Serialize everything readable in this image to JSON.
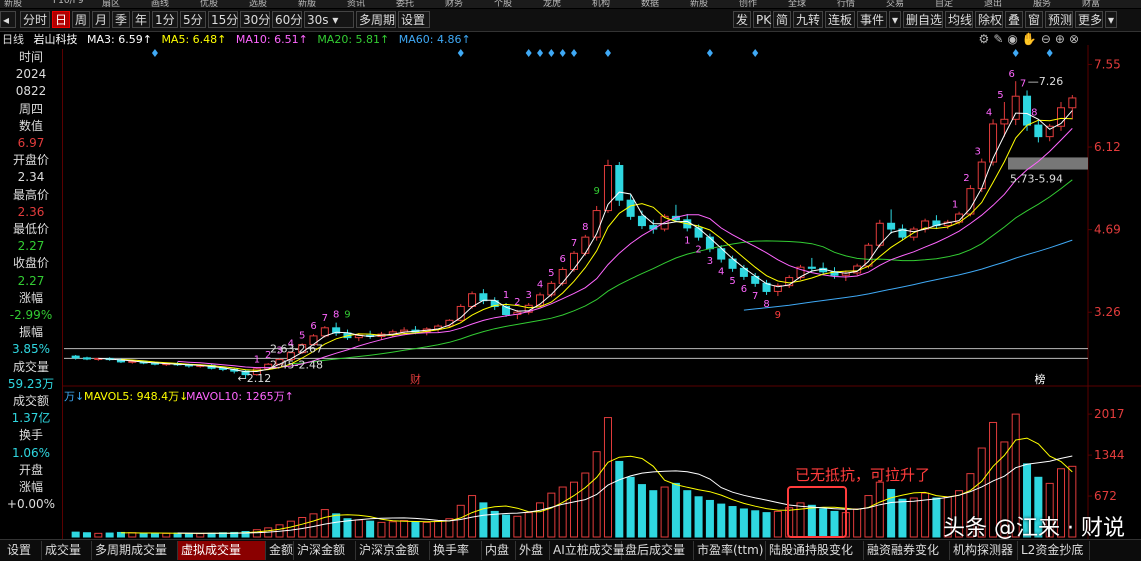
{
  "top_menu": [
    "新股",
    "F10/F9",
    "扇区",
    "画线",
    "优股",
    "选股",
    "新版",
    "资讯",
    "委托",
    "财务",
    "个股",
    "龙虎",
    "机构",
    "数据",
    "新股",
    "创作",
    "全球",
    "行情",
    "交易",
    "自定",
    "退出",
    "服务",
    "财富"
  ],
  "toolbar": {
    "items": [
      "分时",
      "日",
      "周",
      "月",
      "季",
      "年",
      "1分",
      "5分",
      "15分",
      "30分",
      "60分",
      "30s ▾",
      "多周期",
      "设置"
    ],
    "right_items": [
      "发",
      "PK",
      "简",
      "九转",
      "连板",
      "事件",
      "▾",
      "删自选",
      "均线",
      "除权",
      "叠",
      "窗",
      "预测",
      "更多",
      "▾"
    ]
  },
  "ma_bar": {
    "period": "日线",
    "name": "岩山科技",
    "ma3": "MA3: 6.59↑",
    "ma5": "MA5: 6.48↑",
    "ma10": "MA10: 6.51↑",
    "ma20": "MA20: 5.81↑",
    "ma60": "MA60: 4.86↑"
  },
  "colors": {
    "up": "#e23c3c",
    "down": "#2fd7e0",
    "ma3": "#ffffff",
    "ma5": "#ffff00",
    "ma10": "#ff66ff",
    "ma20": "#33cc33",
    "ma60": "#3fa9f5",
    "axis": "#5a0000"
  },
  "side_panel": [
    {
      "text": "时间",
      "color": "#ddd"
    },
    {
      "text": "2024",
      "color": "#ddd"
    },
    {
      "text": "0822",
      "color": "#ddd"
    },
    {
      "text": "周四",
      "color": "#ddd"
    },
    {
      "text": "数值",
      "color": "#ddd"
    },
    {
      "text": "6.97",
      "color": "#e23c3c"
    },
    {
      "text": "开盘价",
      "color": "#ddd"
    },
    {
      "text": "2.34",
      "color": "#ddd"
    },
    {
      "text": "最高价",
      "color": "#ddd"
    },
    {
      "text": "2.36",
      "color": "#e23c3c"
    },
    {
      "text": "最低价",
      "color": "#ddd"
    },
    {
      "text": "2.27",
      "color": "#33cc33"
    },
    {
      "text": "收盘价",
      "color": "#ddd"
    },
    {
      "text": "2.27",
      "color": "#33cc33"
    },
    {
      "text": "涨幅",
      "color": "#ddd"
    },
    {
      "text": "-2.99%",
      "color": "#33cc33"
    },
    {
      "text": "振幅",
      "color": "#ddd"
    },
    {
      "text": "3.85%",
      "color": "#2fd7e0"
    },
    {
      "text": "成交量",
      "color": "#ddd"
    },
    {
      "text": "59.23万",
      "color": "#2fd7e0"
    },
    {
      "text": "成交额",
      "color": "#ddd"
    },
    {
      "text": "1.37亿",
      "color": "#2fd7e0"
    },
    {
      "text": "换手",
      "color": "#ddd"
    },
    {
      "text": "1.06%",
      "color": "#2fd7e0"
    },
    {
      "text": "开盘",
      "color": "#ddd"
    },
    {
      "text": "涨幅",
      "color": "#ddd"
    },
    {
      "text": "+0.00%",
      "color": "#ddd"
    }
  ],
  "price_axis": [
    "7.55",
    "6.12",
    "4.69",
    "3.26"
  ],
  "volume_axis": [
    "2017",
    "1344",
    "672"
  ],
  "volume_header": {
    "prefix": "万↓",
    "mavol5": "MAVOL5: 948.4万↓",
    "mavol10": "MAVOL10: 1265万↑"
  },
  "annotations": {
    "high": "7.26",
    "low": "2.12",
    "range1": "5.73-5.94",
    "range2": "2.63-2.67",
    "range3": "2.45-2.48",
    "tag_cai": "财",
    "tag_bang": "榜"
  },
  "watermark": "头条 @江来 · 财说",
  "note": "已无抵抗，可拉升了",
  "chart_data": {
    "type": "candlestick",
    "ylim": [
      2.0,
      7.8
    ],
    "price_ticks": [
      7.55,
      6.12,
      4.69,
      3.26
    ],
    "volume_ticks": [
      2017,
      1344,
      672
    ],
    "candles": [
      [
        2.5,
        2.52,
        2.44,
        2.47
      ],
      [
        2.47,
        2.49,
        2.43,
        2.45
      ],
      [
        2.45,
        2.47,
        2.42,
        2.46
      ],
      [
        2.46,
        2.48,
        2.42,
        2.44
      ],
      [
        2.44,
        2.46,
        2.38,
        2.4
      ],
      [
        2.4,
        2.43,
        2.37,
        2.41
      ],
      [
        2.41,
        2.42,
        2.36,
        2.38
      ],
      [
        2.38,
        2.4,
        2.34,
        2.36
      ],
      [
        2.36,
        2.39,
        2.33,
        2.37
      ],
      [
        2.37,
        2.4,
        2.33,
        2.35
      ],
      [
        2.35,
        2.37,
        2.3,
        2.33
      ],
      [
        2.33,
        2.36,
        2.3,
        2.34
      ],
      [
        2.34,
        2.36,
        2.27,
        2.29
      ],
      [
        2.29,
        2.31,
        2.24,
        2.27
      ],
      [
        2.27,
        2.29,
        2.2,
        2.24
      ],
      [
        2.24,
        2.27,
        2.12,
        2.18
      ],
      [
        2.18,
        2.3,
        2.16,
        2.28
      ],
      [
        2.28,
        2.38,
        2.26,
        2.36
      ],
      [
        2.36,
        2.46,
        2.34,
        2.44
      ],
      [
        2.44,
        2.58,
        2.42,
        2.56
      ],
      [
        2.56,
        2.72,
        2.54,
        2.7
      ],
      [
        2.7,
        2.88,
        2.68,
        2.85
      ],
      [
        2.85,
        3.02,
        2.82,
        2.99
      ],
      [
        2.99,
        3.08,
        2.85,
        2.9
      ],
      [
        2.9,
        2.96,
        2.78,
        2.82
      ],
      [
        2.82,
        2.9,
        2.76,
        2.86
      ],
      [
        2.86,
        2.94,
        2.8,
        2.84
      ],
      [
        2.84,
        2.92,
        2.78,
        2.88
      ],
      [
        2.88,
        2.96,
        2.84,
        2.92
      ],
      [
        2.92,
        3.0,
        2.86,
        2.95
      ],
      [
        2.95,
        3.02,
        2.88,
        2.92
      ],
      [
        2.92,
        3.0,
        2.86,
        2.97
      ],
      [
        2.97,
        3.05,
        2.92,
        3.02
      ],
      [
        3.02,
        3.14,
        3.0,
        3.12
      ],
      [
        3.12,
        3.4,
        3.1,
        3.36
      ],
      [
        3.36,
        3.62,
        3.32,
        3.58
      ],
      [
        3.58,
        3.66,
        3.4,
        3.46
      ],
      [
        3.46,
        3.52,
        3.3,
        3.36
      ],
      [
        3.36,
        3.42,
        3.18,
        3.22
      ],
      [
        3.22,
        3.3,
        3.14,
        3.26
      ],
      [
        3.26,
        3.42,
        3.22,
        3.38
      ],
      [
        3.38,
        3.6,
        3.36,
        3.56
      ],
      [
        3.56,
        3.8,
        3.52,
        3.76
      ],
      [
        3.76,
        4.04,
        3.72,
        4.0
      ],
      [
        4.0,
        4.32,
        3.96,
        4.28
      ],
      [
        4.28,
        4.6,
        4.24,
        4.56
      ],
      [
        4.56,
        5.1,
        4.5,
        5.02
      ],
      [
        5.02,
        5.9,
        4.98,
        5.8
      ],
      [
        5.8,
        5.86,
        5.1,
        5.2
      ],
      [
        5.2,
        5.3,
        4.86,
        4.92
      ],
      [
        4.92,
        5.02,
        4.7,
        4.76
      ],
      [
        4.76,
        4.86,
        4.62,
        4.7
      ],
      [
        4.7,
        4.96,
        4.66,
        4.92
      ],
      [
        4.92,
        5.12,
        4.82,
        4.86
      ],
      [
        4.86,
        4.96,
        4.66,
        4.72
      ],
      [
        4.72,
        4.78,
        4.5,
        4.56
      ],
      [
        4.56,
        4.62,
        4.3,
        4.36
      ],
      [
        4.36,
        4.42,
        4.12,
        4.18
      ],
      [
        4.18,
        4.24,
        3.96,
        4.02
      ],
      [
        4.02,
        4.08,
        3.82,
        3.88
      ],
      [
        3.88,
        3.94,
        3.7,
        3.76
      ],
      [
        3.76,
        3.82,
        3.56,
        3.62
      ],
      [
        3.62,
        3.76,
        3.54,
        3.72
      ],
      [
        3.72,
        3.9,
        3.68,
        3.86
      ],
      [
        3.86,
        4.08,
        3.82,
        4.04
      ],
      [
        4.04,
        4.2,
        3.96,
        4.02
      ],
      [
        4.02,
        4.12,
        3.92,
        3.96
      ],
      [
        3.96,
        4.04,
        3.84,
        3.9
      ],
      [
        3.9,
        3.98,
        3.8,
        3.94
      ],
      [
        3.94,
        4.1,
        3.9,
        4.06
      ],
      [
        4.06,
        4.46,
        4.02,
        4.42
      ],
      [
        4.42,
        4.86,
        4.38,
        4.8
      ],
      [
        4.8,
        5.04,
        4.62,
        4.7
      ],
      [
        4.7,
        4.78,
        4.5,
        4.56
      ],
      [
        4.56,
        4.74,
        4.5,
        4.7
      ],
      [
        4.7,
        4.88,
        4.64,
        4.84
      ],
      [
        4.84,
        4.94,
        4.7,
        4.76
      ],
      [
        4.76,
        4.86,
        4.7,
        4.82
      ],
      [
        4.82,
        5.0,
        4.78,
        4.96
      ],
      [
        4.96,
        5.46,
        4.92,
        5.4
      ],
      [
        5.4,
        5.92,
        5.34,
        5.86
      ],
      [
        5.86,
        6.6,
        5.8,
        6.52
      ],
      [
        6.52,
        6.9,
        6.3,
        6.6
      ],
      [
        6.6,
        7.26,
        6.5,
        7.0
      ],
      [
        7.0,
        7.1,
        6.4,
        6.5
      ],
      [
        6.5,
        6.6,
        6.2,
        6.3
      ],
      [
        6.3,
        6.52,
        6.22,
        6.48
      ],
      [
        6.48,
        6.9,
        6.4,
        6.8
      ],
      [
        6.8,
        7.02,
        6.6,
        6.97
      ]
    ],
    "volume": [
      80,
      70,
      60,
      65,
      75,
      70,
      60,
      55,
      60,
      65,
      58,
      55,
      62,
      70,
      75,
      90,
      120,
      150,
      200,
      260,
      320,
      380,
      450,
      380,
      300,
      280,
      260,
      240,
      250,
      270,
      250,
      240,
      260,
      300,
      520,
      680,
      560,
      420,
      360,
      340,
      400,
      560,
      720,
      820,
      900,
      1050,
      1400,
      1960,
      1240,
      980,
      860,
      760,
      820,
      880,
      760,
      660,
      600,
      540,
      500,
      460,
      430,
      400,
      420,
      480,
      560,
      520,
      460,
      420,
      400,
      460,
      680,
      900,
      780,
      620,
      640,
      720,
      640,
      660,
      760,
      1040,
      1460,
      1880,
      1560,
      2017,
      1200,
      980,
      880,
      1120,
      1160
    ]
  },
  "bottom_tabs": [
    "设置",
    "成交量",
    "多周期成交量",
    "虚拟成交量",
    "金额",
    "沪深金额",
    "沪深京金额",
    "换手率",
    "内盘",
    "外盘",
    "AI立桩成交量",
    "盘后成交量",
    "市盈率(ttm)",
    "陆股通持股变化",
    "融资融券变化",
    "机构探测器",
    "L2资金抄底"
  ]
}
